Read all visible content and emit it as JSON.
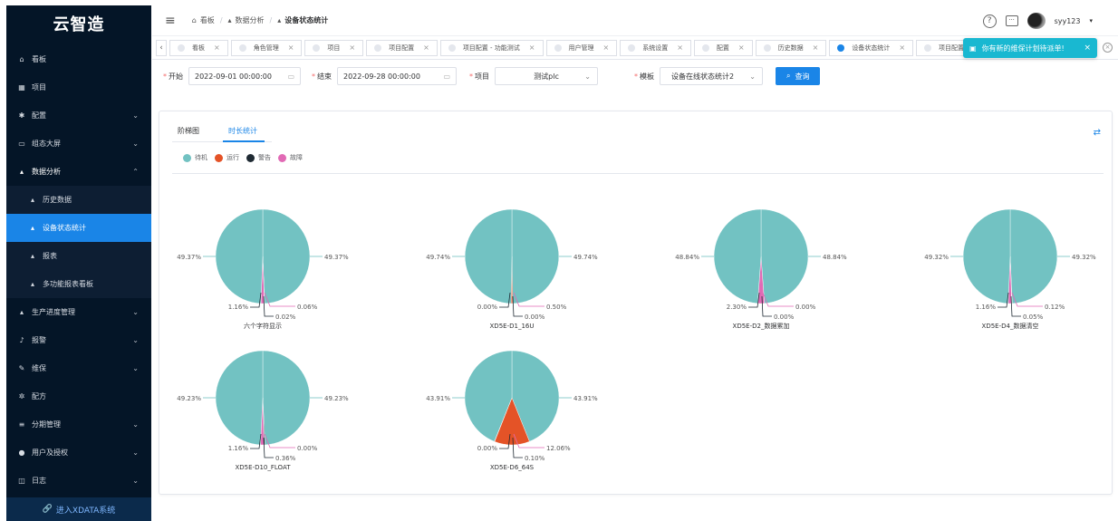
{
  "sidebar": {
    "logo": "云智造",
    "items": [
      {
        "icon": "home-icon",
        "glyph": "⌂",
        "label": "看板"
      },
      {
        "icon": "grid-icon",
        "glyph": "▦",
        "label": "项目"
      },
      {
        "icon": "gear-icon",
        "glyph": "✱",
        "label": "配置",
        "chevron": "⌄"
      },
      {
        "icon": "monitor-icon",
        "glyph": "▭",
        "label": "组态大屏",
        "chevron": "⌄"
      },
      {
        "icon": "chart-icon",
        "glyph": "▴",
        "label": "数据分析",
        "chevron": "⌃"
      },
      {
        "icon": "chart-icon",
        "glyph": "▴",
        "label": "历史数据"
      },
      {
        "icon": "chart-icon",
        "glyph": "▴",
        "label": "设备状态统计"
      },
      {
        "icon": "chart-icon",
        "glyph": "▴",
        "label": "报表"
      },
      {
        "icon": "chart-icon",
        "glyph": "▴",
        "label": "多功能报表看板"
      },
      {
        "icon": "chart-icon",
        "glyph": "▴",
        "label": "生产进度管理",
        "chevron": "⌄"
      },
      {
        "icon": "bell-icon",
        "glyph": "♪",
        "label": "报警",
        "chevron": "⌄"
      },
      {
        "icon": "wrench-icon",
        "glyph": "✎",
        "label": "维保",
        "chevron": "⌄"
      },
      {
        "icon": "recipe-icon",
        "glyph": "✲",
        "label": "配方"
      },
      {
        "icon": "list-icon",
        "glyph": "≡",
        "label": "分期管理",
        "chevron": "⌄"
      },
      {
        "icon": "user-icon",
        "glyph": "●",
        "label": "用户及授权",
        "chevron": "⌄"
      },
      {
        "icon": "log-icon",
        "glyph": "◫",
        "label": "日志",
        "chevron": "⌄"
      }
    ],
    "footer": "进入XDATA系统"
  },
  "topbar": {
    "breadcrumb": [
      "看板",
      "数据分析",
      "设备状态统计"
    ],
    "user": "syy123"
  },
  "tabs": [
    "看板",
    "角色管理",
    "项目",
    "项目配置",
    "项目配置 - 功能测试",
    "用户管理",
    "系统设置",
    "配置",
    "历史数据",
    "设备状态统计",
    "项目配置"
  ],
  "notice": "你有新的维保计划待派单!",
  "filters": {
    "start_label": "开始",
    "start_value": "2022-09-01 00:00:00",
    "end_label": "结束",
    "end_value": "2022-09-28 00:00:00",
    "project_label": "项目",
    "project_value": "测试plc",
    "template_label": "模板",
    "template_value": "设备在线状态统计2",
    "query_label": "查询"
  },
  "subtabs": [
    "阶梯图",
    "时长统计"
  ],
  "legend": [
    {
      "name": "待机",
      "color": "#72c2c2"
    },
    {
      "name": "运行",
      "color": "#e45327"
    },
    {
      "name": "警告",
      "color": "#1f2a33"
    },
    {
      "name": "故障",
      "color": "#e16ab5"
    }
  ],
  "chart_data": [
    {
      "type": "pie",
      "title": "六个字符显示",
      "series": [
        {
          "name": "待机",
          "value": 49.37
        },
        {
          "name": "待机",
          "value": 49.37
        },
        {
          "name": "运行",
          "value": 0.06
        },
        {
          "name": "警告",
          "value": 0.02
        },
        {
          "name": "故障",
          "value": 1.16
        }
      ],
      "labels": [
        "49.37%",
        "49.37%",
        "1.16%",
        "0.06%",
        "0.02%"
      ]
    },
    {
      "type": "pie",
      "title": "XD5E-D1_16U",
      "series": [
        {
          "name": "待机",
          "value": 49.74
        },
        {
          "name": "待机",
          "value": 49.74
        },
        {
          "name": "运行",
          "value": 0.5
        },
        {
          "name": "警告",
          "value": 0.0
        },
        {
          "name": "故障",
          "value": 0.0
        }
      ],
      "labels": [
        "49.74%",
        "49.74%",
        "0.00%",
        "0.50%",
        "0.00%"
      ]
    },
    {
      "type": "pie",
      "title": "XD5E-D2_数据累加",
      "series": [
        {
          "name": "待机",
          "value": 48.84
        },
        {
          "name": "待机",
          "value": 48.84
        },
        {
          "name": "运行",
          "value": 0.0
        },
        {
          "name": "警告",
          "value": 0.0
        },
        {
          "name": "故障",
          "value": 2.3
        }
      ],
      "labels": [
        "48.84%",
        "48.84%",
        "2.30%",
        "0.00%",
        "0.00%"
      ]
    },
    {
      "type": "pie",
      "title": "XD5E-D4_数据清空",
      "series": [
        {
          "name": "待机",
          "value": 49.32
        },
        {
          "name": "待机",
          "value": 49.32
        },
        {
          "name": "运行",
          "value": 0.12
        },
        {
          "name": "警告",
          "value": 0.05
        },
        {
          "name": "故障",
          "value": 1.16
        }
      ],
      "labels": [
        "49.32%",
        "49.32%",
        "1.16%",
        "0.12%",
        "0.05%"
      ]
    },
    {
      "type": "pie",
      "title": "XD5E-D10_FLOAT",
      "series": [
        {
          "name": "待机",
          "value": 49.23
        },
        {
          "name": "待机",
          "value": 49.23
        },
        {
          "name": "运行",
          "value": 0.0
        },
        {
          "name": "警告",
          "value": 0.36
        },
        {
          "name": "故障",
          "value": 1.16
        }
      ],
      "labels": [
        "49.23%",
        "49.23%",
        "1.16%",
        "0.00%",
        "0.36%"
      ]
    },
    {
      "type": "pie",
      "title": "XD5E-D6_64S",
      "series": [
        {
          "name": "待机",
          "value": 43.91
        },
        {
          "name": "待机",
          "value": 43.91
        },
        {
          "name": "运行",
          "value": 12.06
        },
        {
          "name": "警告",
          "value": 0.0
        },
        {
          "name": "故障",
          "value": 0.1
        }
      ],
      "labels": [
        "43.91%",
        "43.91%",
        "0.00%",
        "12.06%",
        "0.10%"
      ]
    }
  ]
}
